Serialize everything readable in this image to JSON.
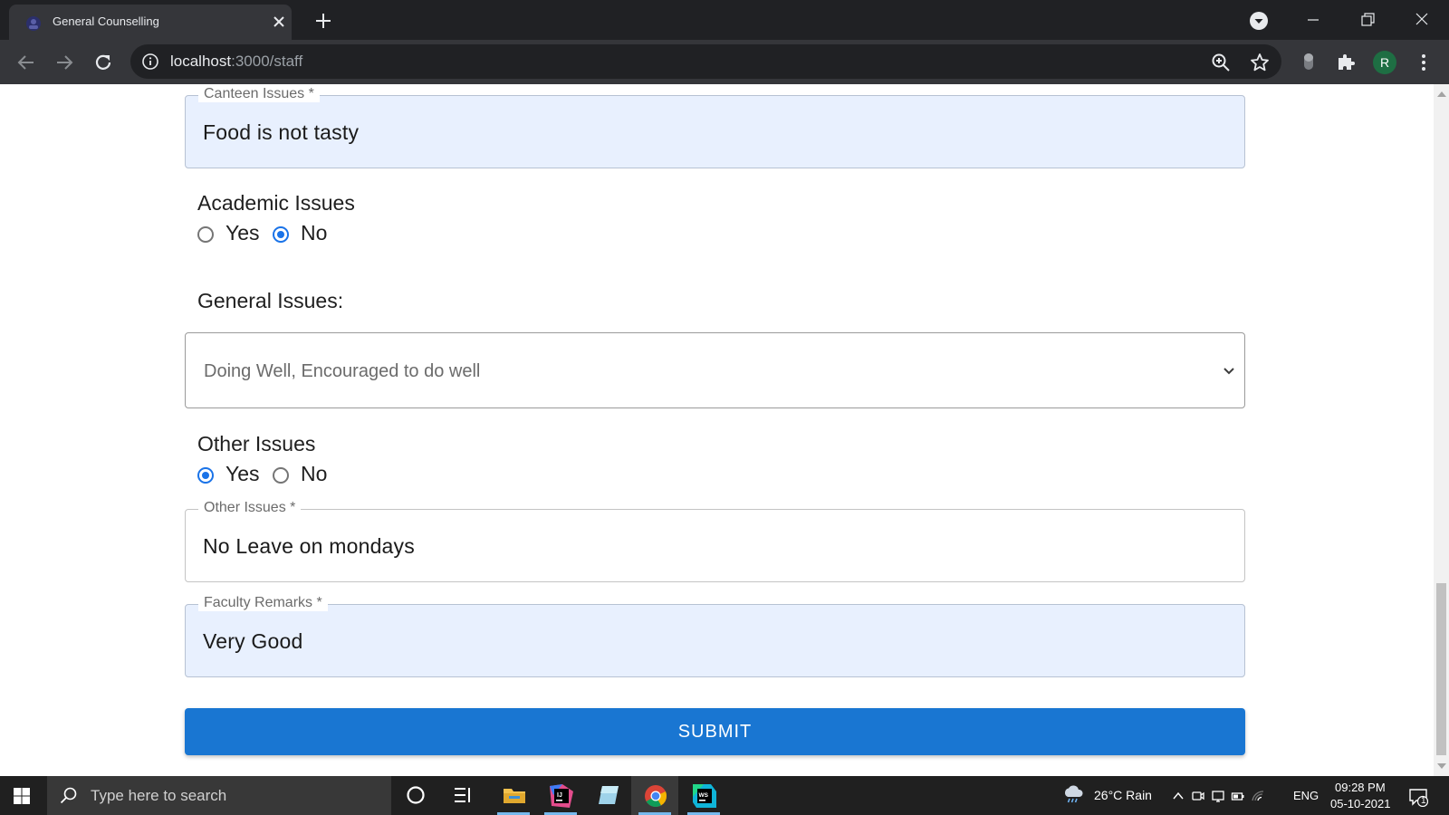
{
  "browser": {
    "tab_title": "General Counselling",
    "url_host": "localhost",
    "url_path": ":3000/staff",
    "avatar_letter": "R"
  },
  "form": {
    "canteen": {
      "label": "Canteen Issues *",
      "value": "Food is not tasty"
    },
    "academic": {
      "label": "Academic Issues",
      "options": [
        "Yes",
        "No"
      ],
      "selected": "No"
    },
    "general": {
      "label": "General Issues:",
      "value": "Doing Well, Encouraged to do well"
    },
    "other": {
      "label": "Other Issues",
      "options": [
        "Yes",
        "No"
      ],
      "selected": "Yes"
    },
    "other_text": {
      "label": "Other Issues *",
      "value": "No Leave on mondays"
    },
    "remarks": {
      "label": "Faculty Remarks *",
      "value": "Very Good"
    },
    "submit_label": "SUBMIT"
  },
  "taskbar": {
    "search_placeholder": "Type here to search",
    "weather": "26°C  Rain",
    "lang": "ENG",
    "time": "09:28 PM",
    "date": "05-10-2021",
    "notification_count": "1"
  },
  "colors": {
    "primary": "#1976d2",
    "radio_checked": "#1a73e8",
    "autofill_bg": "#e8f0fe"
  }
}
